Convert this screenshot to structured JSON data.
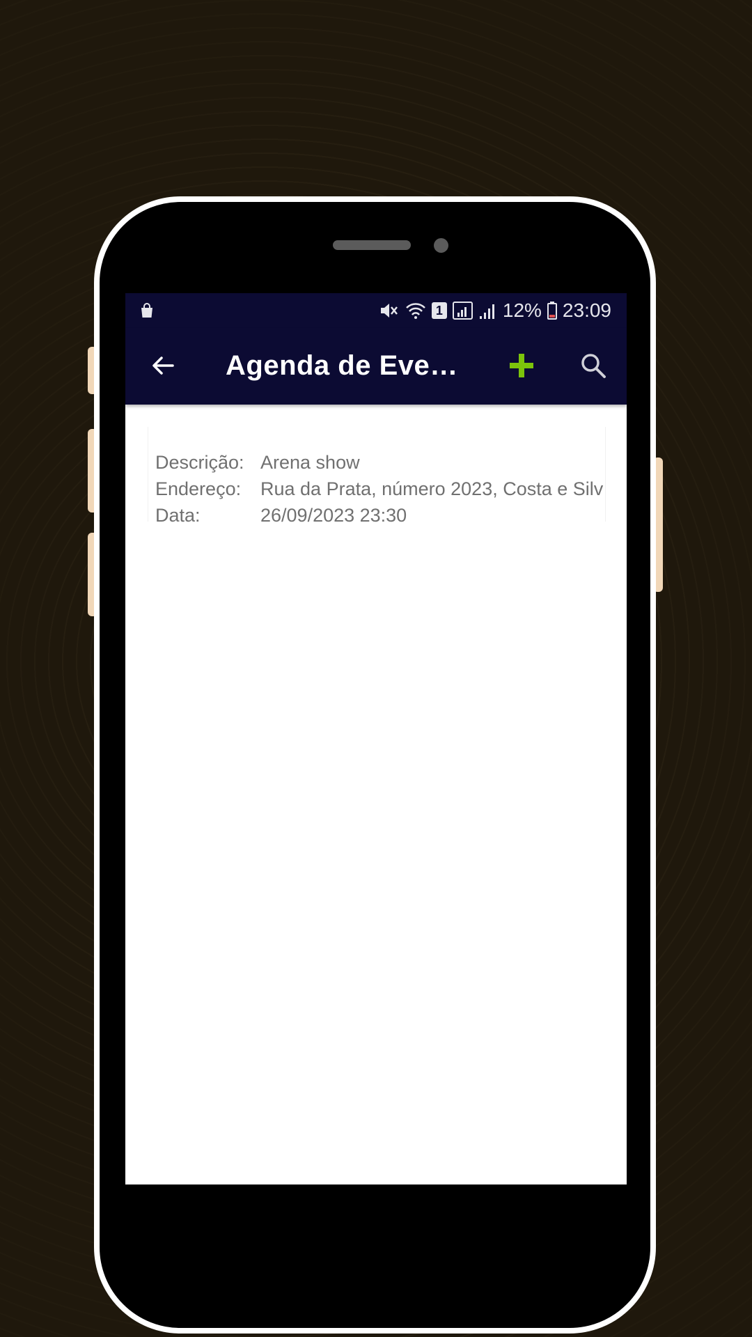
{
  "status_bar": {
    "battery_percent": "12%",
    "time": "23:09",
    "sim_slot": "1",
    "icons": [
      "shopping-bag-icon",
      "mute-vibrate-icon",
      "wifi-icon",
      "sim-icon",
      "signal-icon",
      "battery-icon"
    ]
  },
  "app_bar": {
    "title": "Agenda de Eventos",
    "back_icon": "arrow-left-icon",
    "add_icon": "plus-icon",
    "search_icon": "search-icon"
  },
  "colors": {
    "appbar_bg": "#0c0b33",
    "add_icon": "#7cc40b",
    "text_gray": "#707070"
  },
  "event": {
    "description_label": "Descrição:",
    "description_value": "Arena show",
    "address_label": "Endereço:",
    "address_value": "Rua da Prata, número 2023, Costa e Silv",
    "date_label": "Data:",
    "date_value": "26/09/2023 23:30"
  }
}
